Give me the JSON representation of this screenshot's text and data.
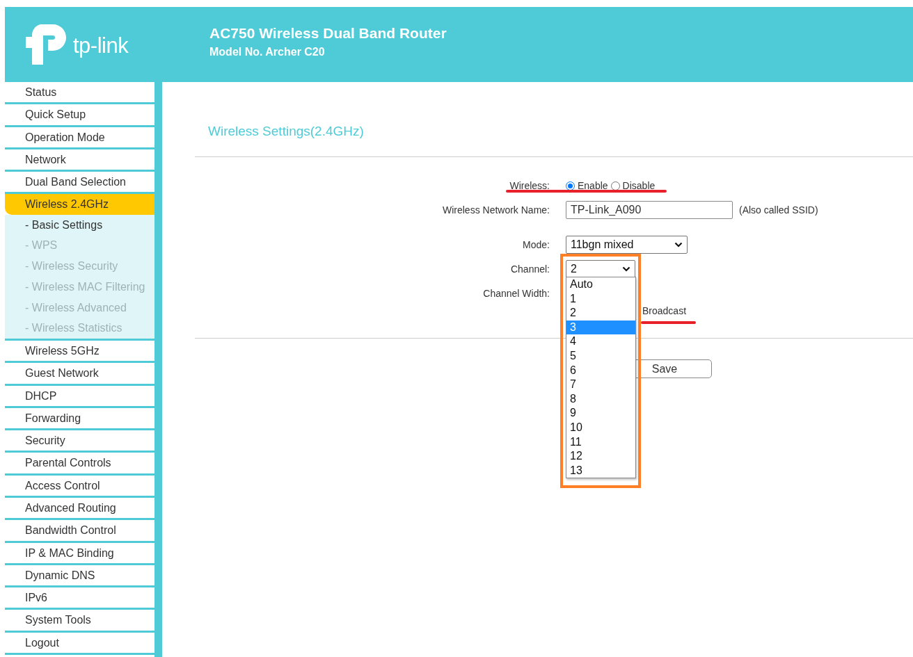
{
  "header": {
    "logo_text": "tp-link",
    "title": "AC750 Wireless Dual Band Router",
    "model": "Model No. Archer C20"
  },
  "sidebar": {
    "items": [
      {
        "label": "Status",
        "selected": false
      },
      {
        "label": "Quick Setup",
        "selected": false
      },
      {
        "label": "Operation Mode",
        "selected": false
      },
      {
        "label": "Network",
        "selected": false
      },
      {
        "label": "Dual Band Selection",
        "selected": false
      },
      {
        "label": "Wireless 2.4GHz",
        "selected": true,
        "children": [
          {
            "label": "- Basic Settings",
            "selected": true
          },
          {
            "label": "- WPS",
            "selected": false
          },
          {
            "label": "- Wireless Security",
            "selected": false
          },
          {
            "label": "- Wireless MAC Filtering",
            "selected": false
          },
          {
            "label": "- Wireless Advanced",
            "selected": false
          },
          {
            "label": "- Wireless Statistics",
            "selected": false
          }
        ]
      },
      {
        "label": "Wireless 5GHz",
        "selected": false
      },
      {
        "label": "Guest Network",
        "selected": false
      },
      {
        "label": "DHCP",
        "selected": false
      },
      {
        "label": "Forwarding",
        "selected": false
      },
      {
        "label": "Security",
        "selected": false
      },
      {
        "label": "Parental Controls",
        "selected": false
      },
      {
        "label": "Access Control",
        "selected": false
      },
      {
        "label": "Advanced Routing",
        "selected": false
      },
      {
        "label": "Bandwidth Control",
        "selected": false
      },
      {
        "label": "IP & MAC Binding",
        "selected": false
      },
      {
        "label": "Dynamic DNS",
        "selected": false
      },
      {
        "label": "IPv6",
        "selected": false
      },
      {
        "label": "System Tools",
        "selected": false
      },
      {
        "label": "Logout",
        "selected": false
      }
    ]
  },
  "page": {
    "title": "Wireless Settings(2.4GHz)",
    "wireless": {
      "label": "Wireless:",
      "options": [
        {
          "label": "Enable",
          "selected": true
        },
        {
          "label": "Disable",
          "selected": false
        }
      ]
    },
    "network_name": {
      "label": "Wireless Network Name:",
      "value": "TP-Link_A090",
      "note": "(Also called SSID)"
    },
    "mode": {
      "label": "Mode:",
      "value": "11bgn mixed"
    },
    "channel": {
      "label": "Channel:",
      "value": "2",
      "options": [
        {
          "label": "Auto",
          "highlighted": false
        },
        {
          "label": "1",
          "highlighted": false
        },
        {
          "label": "2",
          "highlighted": false
        },
        {
          "label": "3",
          "highlighted": true
        },
        {
          "label": "4",
          "highlighted": false
        },
        {
          "label": "5",
          "highlighted": false
        },
        {
          "label": "6",
          "highlighted": false
        },
        {
          "label": "7",
          "highlighted": false
        },
        {
          "label": "8",
          "highlighted": false
        },
        {
          "label": "9",
          "highlighted": false
        },
        {
          "label": "10",
          "highlighted": false
        },
        {
          "label": "11",
          "highlighted": false
        },
        {
          "label": "12",
          "highlighted": false
        },
        {
          "label": "13",
          "highlighted": false
        }
      ]
    },
    "channel_width": {
      "label": "Channel Width:"
    },
    "broadcast": {
      "label": "Broadcast"
    },
    "save_button": "Save"
  }
}
